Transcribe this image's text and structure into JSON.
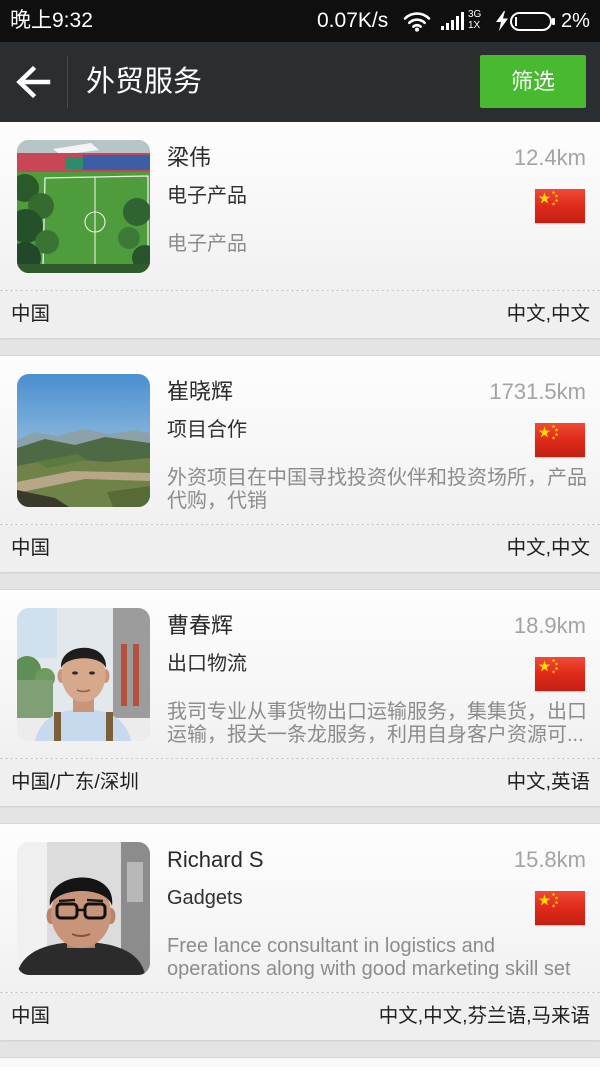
{
  "status_bar": {
    "time": "晚上9:32",
    "net_speed": "0.07K/s",
    "network_top": "3G",
    "network_bottom": "1X",
    "battery": "2%"
  },
  "header": {
    "title": "外贸服务",
    "filter_label": "筛选"
  },
  "colors": {
    "accent": "#47ba2f",
    "header_bg": "#2b2e31",
    "status_bg": "#0f0f0f",
    "page_bg": "#e4e4e4"
  },
  "icons": {
    "back": "arrow-left-icon",
    "wifi": "wifi-icon",
    "signal": "signal-icon",
    "charging": "bolt-icon",
    "battery": "battery-icon",
    "flag": "china-flag-icon"
  },
  "list": [
    {
      "name": "梁伟",
      "distance": "12.4km",
      "category": "电子产品",
      "description": "电子产品",
      "location": "中国",
      "languages": "中文,中文"
    },
    {
      "name": "崔晓辉",
      "distance": "1731.5km",
      "category": "项目合作",
      "description": "外资项目在中国寻找投资伙伴和投资场所，产品代购，代销",
      "location": "中国",
      "languages": "中文,中文"
    },
    {
      "name": "曹春辉",
      "distance": "18.9km",
      "category": "出口物流",
      "description": "我司专业从事货物出口运输服务，集集货，出口运输，报关一条龙服务，利用自身客户资源可...",
      "location": "中国/广东/深圳",
      "languages": "中文,英语"
    },
    {
      "name": "Richard S",
      "distance": "15.8km",
      "category": "Gadgets",
      "description": "Free lance consultant in logistics and operations along with good marketing skill set",
      "location": "中国",
      "languages": "中文,中文,芬兰语,马来语"
    }
  ]
}
